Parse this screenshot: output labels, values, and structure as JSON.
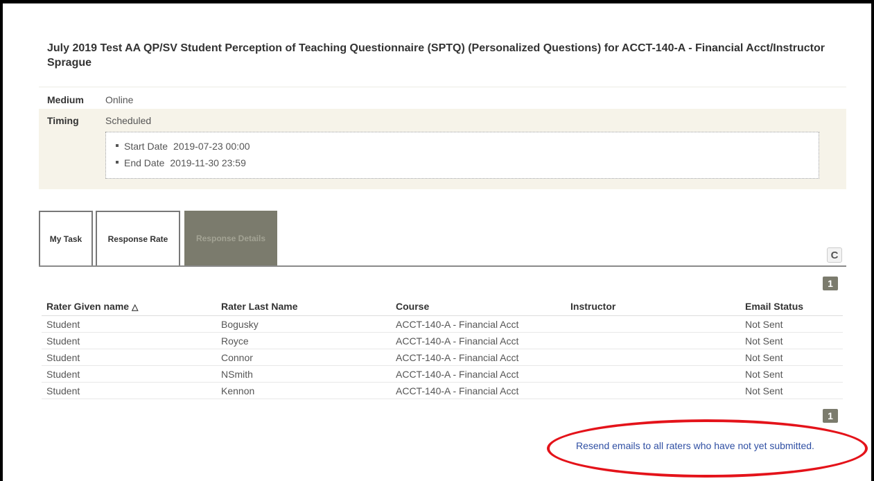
{
  "title": "July 2019 Test AA QP/SV Student Perception of Teaching Questionnaire (SPTQ) (Personalized Questions) for ACCT-140-A - Financial Acct/Instructor Sprague",
  "info": {
    "medium_label": "Medium",
    "medium_value": "Online",
    "timing_label": "Timing",
    "timing_value": "Scheduled",
    "start_label": "Start Date",
    "start_value": "2019-07-23 00:00",
    "end_label": "End Date",
    "end_value": "2019-11-30 23:59"
  },
  "tabs": [
    {
      "label": "My Task"
    },
    {
      "label": "Response Rate"
    },
    {
      "label": "Response Details",
      "active": true
    }
  ],
  "icons": {
    "refresh": "refresh-icon",
    "sort": "sort-ascending-icon"
  },
  "pagination": {
    "page": "1"
  },
  "table": {
    "headers": [
      "Rater Given name",
      "Rater Last Name",
      "Course",
      "Instructor",
      "Email Status"
    ],
    "sort_glyph": "△",
    "rows": [
      [
        "Student",
        "Bogusky",
        "ACCT-140-A - Financial Acct",
        "",
        "Not Sent"
      ],
      [
        "Student",
        "Royce",
        "ACCT-140-A - Financial Acct",
        "",
        "Not Sent"
      ],
      [
        "Student",
        "Connor",
        "ACCT-140-A - Financial Acct",
        "",
        "Not Sent"
      ],
      [
        "Student",
        "NSmith",
        "ACCT-140-A - Financial Acct",
        "",
        "Not Sent"
      ],
      [
        "Student",
        "Kennon",
        "ACCT-140-A - Financial Acct",
        "",
        "Not Sent"
      ]
    ]
  },
  "resend_link": "Resend emails to all raters who have not yet submitted.",
  "colors": {
    "active_tab": "#7b7b6d",
    "timing_background": "#f6f3e9",
    "link": "#2f4fa3",
    "annotation": "#e4131a"
  }
}
